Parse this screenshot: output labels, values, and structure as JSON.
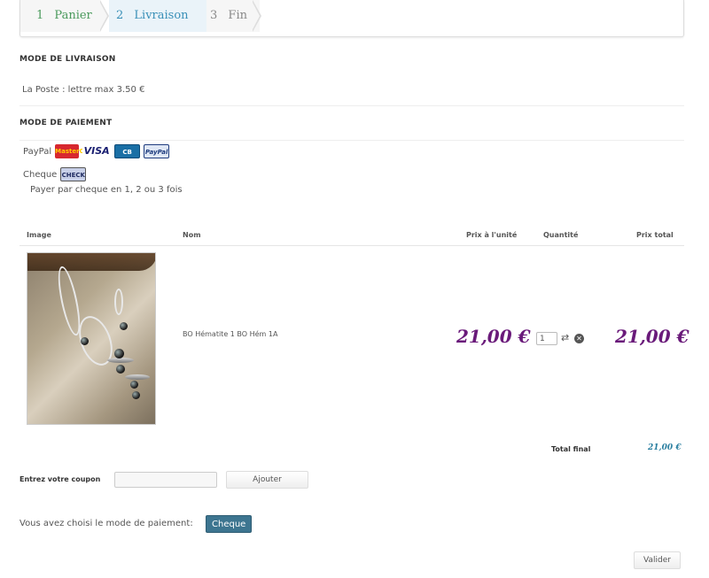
{
  "steps": [
    {
      "num": "1",
      "label": "Panier"
    },
    {
      "num": "2",
      "label": "Livraison"
    },
    {
      "num": "3",
      "label": "Fin"
    }
  ],
  "shipping": {
    "title": "MODE DE LIVRAISON",
    "option": "La Poste : lettre max 3.50 €"
  },
  "payment": {
    "title": "MODE DE PAIEMENT",
    "paypal_label": "PayPal",
    "logos": {
      "mastercard": "MasterCard",
      "visa": "VISA",
      "cb": "CB",
      "paypal": "PayPal",
      "check": "CHECK"
    },
    "cheque_label": "Cheque",
    "cheque_desc": "Payer par cheque en 1, 2 ou 3 fois"
  },
  "table": {
    "headers": {
      "image": "Image",
      "name": "Nom",
      "unit_price": "Prix à l'unité",
      "qty": "Quantité",
      "total": "Prix total"
    },
    "rows": [
      {
        "name": "BO Hématite 1 BO Hém 1A",
        "unit_price": "21,00 €",
        "qty": "1",
        "total": "21,00 €"
      }
    ]
  },
  "total": {
    "label": "Total final",
    "value": "21,00 €"
  },
  "coupon": {
    "label": "Entrez votre coupon",
    "placeholder": "",
    "button": "Ajouter"
  },
  "chosen": {
    "label": "Vous avez choisi le mode de paiement:",
    "badge": "Cheque"
  },
  "submit": {
    "label": "Valider"
  },
  "colors": {
    "price": "#6a1a7a",
    "total": "#2a7fa0",
    "badge": "#3d7590"
  }
}
